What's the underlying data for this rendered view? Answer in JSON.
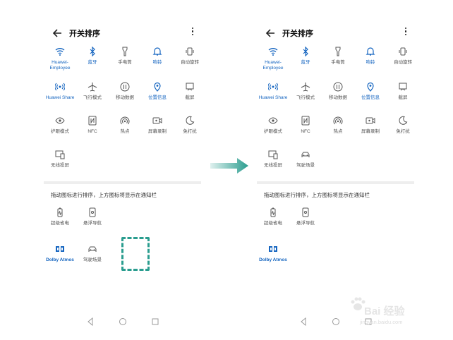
{
  "screen": {
    "title": "开关排序",
    "drag_hint": "拖动图标进行排序，上方图标将显示在通知栏"
  },
  "left_panel": {
    "grid": [
      {
        "label": "Huawei-Employee",
        "icon": "wifi-icon",
        "active": true
      },
      {
        "label": "蓝牙",
        "icon": "bluetooth-icon",
        "active": true
      },
      {
        "label": "手电筒",
        "icon": "flashlight-icon",
        "active": false
      },
      {
        "label": "响铃",
        "icon": "bell-icon",
        "active": true
      },
      {
        "label": "自动旋转",
        "icon": "rotate-icon",
        "active": false
      },
      {
        "label": "Huawei Share",
        "icon": "share-icon",
        "active": true
      },
      {
        "label": "飞行模式",
        "icon": "airplane-icon",
        "active": false
      },
      {
        "label": "移动数据",
        "icon": "mobile-data-icon",
        "active": false
      },
      {
        "label": "位置信息",
        "icon": "location-icon",
        "active": true
      },
      {
        "label": "截屏",
        "icon": "screenshot-icon",
        "active": false
      },
      {
        "label": "护眼模式",
        "icon": "eye-icon",
        "active": false
      },
      {
        "label": "NFC",
        "icon": "nfc-icon",
        "active": false
      },
      {
        "label": "热点",
        "icon": "hotspot-icon",
        "active": false
      },
      {
        "label": "屏幕录制",
        "icon": "screen-record-icon",
        "active": false
      },
      {
        "label": "免打扰",
        "icon": "moon-icon",
        "active": false
      },
      {
        "label": "无线投屏",
        "icon": "cast-icon",
        "active": false
      }
    ],
    "extra": [
      {
        "label": "超级省电",
        "icon": "battery-icon",
        "active": false
      },
      {
        "label": "悬浮导航",
        "icon": "floating-nav-icon",
        "active": false
      },
      {
        "label": "Dolby Atmos",
        "icon": "dolby-icon",
        "active": true
      },
      {
        "label": "驾驶场景",
        "icon": "car-icon",
        "active": false
      }
    ]
  },
  "right_panel": {
    "grid_last": {
      "label": "驾驶场景",
      "icon": "car-icon",
      "active": false
    },
    "extra": [
      {
        "label": "超级省电",
        "icon": "battery-icon",
        "active": false
      },
      {
        "label": "悬浮导航",
        "icon": "floating-nav-icon",
        "active": false
      },
      {
        "label": "Dolby Atmos",
        "icon": "dolby-icon",
        "active": true
      }
    ]
  },
  "watermark": {
    "text": "Bai 经验",
    "url": "jingyan.baidu.com"
  },
  "colors": {
    "active": "#1565c0",
    "inactive": "#555555",
    "highlight": "#2a9d8f"
  }
}
